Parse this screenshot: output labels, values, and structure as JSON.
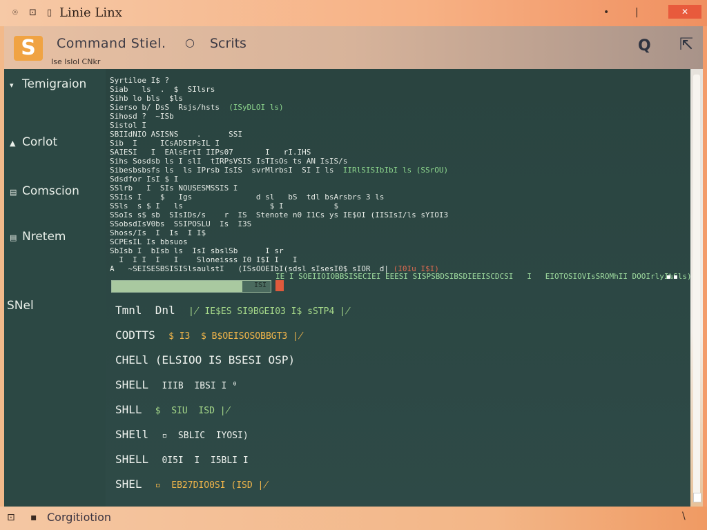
{
  "window": {
    "icons": [
      "⌾",
      "⊡",
      "▯"
    ],
    "title": "Linie Linx",
    "buttons": [
      "•",
      "|",
      "✕"
    ]
  },
  "header": {
    "logo": "S",
    "title": "Command Stiel.",
    "circle": "○",
    "scripts": "Scrits",
    "subtitle": "Ise Islol CNkr",
    "btn1": "Q",
    "btn2": "⇱"
  },
  "sidebar": {
    "items": [
      {
        "icon": "▾",
        "label": "Temigraion"
      },
      {
        "icon": "▲",
        "label": "Corlot"
      },
      {
        "icon": "▤",
        "label": "Comscion"
      },
      {
        "icon": "▤",
        "label": "Nretem"
      },
      {
        "icon": "",
        "label": "SNel"
      }
    ]
  },
  "terminal": {
    "lines": [
      {
        "a": "Syrtiloe I$ ?"
      },
      {
        "a": "Siab   ls  .  $  SIlsrs"
      },
      {
        "a": "Sihb lo bls  $ls"
      },
      {
        "a": "Sierso b/ DsS  Rsjs/hsts  ",
        "g": "(ISyDLOI ls)"
      },
      {
        "a": "Sihosd ?  ~ISb"
      },
      {
        "a": "Sistol I"
      },
      {
        "a": "SBIIdNIO ASISNS    .      SSI"
      },
      {
        "a": "Sib  I     ICsADSIPsIL I"
      },
      {
        "a": "SAIESI   I  EAlsErtI IIPs07       I   rI.IHS"
      },
      {
        "a": "Sihs Sosdsb ls I slI  tIRPsVSIS IsTIsOs ts AN IsIS/s"
      },
      {
        "a": "Sibesbsbsfs ls  ls IPrsb IsIS  svrMlrbsI  SI I ls  ",
        "g": "IIRlSISIbIbI ls (SSrOU)"
      },
      {
        "a": "Sdsdfor IsI $ I"
      },
      {
        "a": "SSlrb   I  SIs NOUSESMSSIS I"
      },
      {
        "a": "SSIis I    $   Igs              d sl   bS  tdl bsArsbrs 3 ls"
      },
      {
        "a": "SSls  s $ I   ls                   $ I           $"
      },
      {
        "a": "SSoIs s$ sb  SIsIDs/s    r  IS  ",
        "w": "Stenote n0 I1Cs ys IE$OI (IISIsI/ls sYIOI3"
      },
      {
        "a": "SSobsdIsV0bs  SSIPOSLU  Is  I3S"
      },
      {
        "a": "Shoss/Is  I  Is  I I$"
      },
      {
        "a": "SCPEsIL Is bbsuos"
      },
      {
        "a": "SbIsb I  bIsb ls  IsI sbslSb      I sr"
      },
      {
        "a": "  I  I I  I   I    Sloneisss I0 I$I I   I"
      },
      {
        "a": "A   ~SEISESBSISISlsaulstI   ",
        "w": "(ISsOOEIbI(sdsl sIsesI0$ sIOR  d|",
        "r": " (I0Iu I$I)"
      }
    ],
    "bar": {
      "fill": 0.82,
      "value": "ISI"
    },
    "bar_tail": "IE I SOEIIOIOBBSISECIEI EEESI SISPSBDSIBSDIEEISCDCSI   I   EIOTOSIOVIsSROMhII DOOIrlyI%Sls)",
    "tail_glyph": "▪ ▪",
    "commands": [
      {
        "name": "Tmnl  Dnl",
        "val": "∤ IE$ES SI9BGEI03 I$ sSTP4 ∤",
        "color": "#a6d98a"
      },
      {
        "name": "CODTTS",
        "val": "$ I3  $ B$OEISOSOBBGT3 ∤",
        "color": "#f2b64a"
      },
      {
        "name": "CHELl (ELSIOO IS BSESI OSP)",
        "val": "",
        "color": "#eef2ee"
      },
      {
        "name": "SHELL",
        "val": "IIIB  IBSI I ⁰",
        "color": "#eef2ee"
      },
      {
        "name": "SHLL",
        "val": "$  SIU  ISD ∤",
        "color": "#a6d98a"
      },
      {
        "name": "SHEll",
        "val": "▫  SBLIC  IYOSI)",
        "color": "#eef2ee"
      },
      {
        "name": "SHELL",
        "val": "0I5I  I  I5BLI I",
        "color": "#eef2ee"
      },
      {
        "name": "SHEL",
        "val": "▫  EB27DIO0SI (ISD ∤",
        "color": "#f2b64a"
      }
    ]
  },
  "statusbar": {
    "icon_a": "⊡",
    "icon_b": "▪",
    "text": "Corgitiotion",
    "right": "\\"
  }
}
